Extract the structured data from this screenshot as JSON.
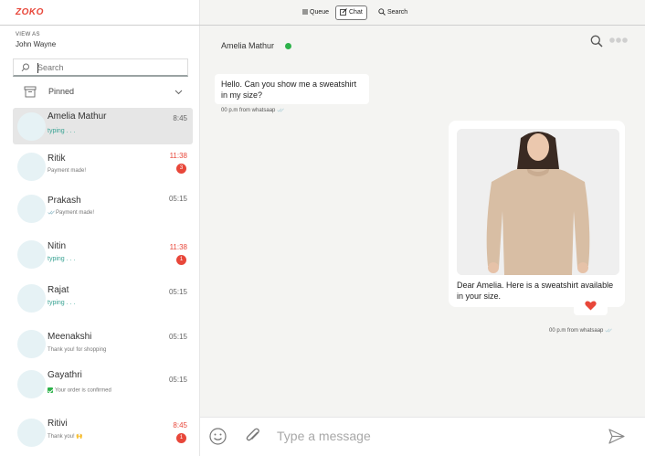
{
  "brand": {
    "name": "ZOKO",
    "color": "#e8473a"
  },
  "sidebar": {
    "view_as_label": "VIEW AS",
    "view_as_name": "John Wayne",
    "search_placeholder": "Search",
    "pinned_label": "Pinned",
    "chats": [
      {
        "name": "Amelia Mathur",
        "subtitle": "typing . . .",
        "time": "8:45",
        "badge": "",
        "active": true
      },
      {
        "name": "Ritik",
        "subtitle": "Payment made!",
        "time": "11:38",
        "badge": "3"
      },
      {
        "name": "Prakash",
        "subtitle": "Payment made!",
        "time": "05:15",
        "badge": ""
      },
      {
        "name": "Nitin",
        "subtitle": "typing . . .",
        "time": "11:38",
        "badge": "1"
      },
      {
        "name": "Rajat",
        "subtitle": "typing . . .",
        "time": "05:15",
        "badge": ""
      },
      {
        "name": "Meenakshi",
        "subtitle": "Thank you! for shopping",
        "time": "05:15",
        "badge": ""
      },
      {
        "name": "Gayathri",
        "subtitle": "Your order is confirmed",
        "time": "05:15",
        "badge": ""
      },
      {
        "name": "Ritivi",
        "subtitle": "Thank you! 🙌",
        "time": "8:45",
        "badge": "1"
      }
    ]
  },
  "topbar": {
    "queue_label": "Queue",
    "chat_label": "Chat",
    "search_label": "Search"
  },
  "conversation": {
    "contact_name": "Amelia Mathur",
    "status_color": "#2db24a",
    "incoming": {
      "text": "Hello. Can you show me a sweatshirt in my size?",
      "meta": "00 p.m from whatsaap"
    },
    "outgoing": {
      "caption": "Dear Amelia. Here is a sweatshirt available in your size.",
      "meta": "00 p.m from whatsaap",
      "reaction": "heart-icon"
    }
  },
  "composer": {
    "placeholder": "Type a message"
  }
}
